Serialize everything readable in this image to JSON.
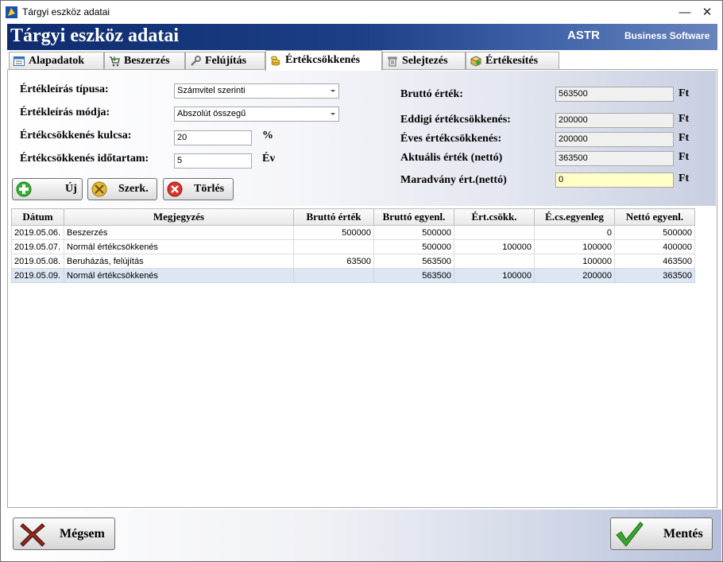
{
  "window": {
    "title": "Tárgyi eszköz adatai",
    "minimize": "—",
    "close": "✕"
  },
  "banner": {
    "heading": "Tárgyi eszköz adatai",
    "brand": "ASTR",
    "brand_sub": "Business Software"
  },
  "tabs": [
    {
      "label": "Alapadatok",
      "icon": "form-icon"
    },
    {
      "label": "Beszerzés",
      "icon": "cart-icon"
    },
    {
      "label": "Felújítás",
      "icon": "wrench-icon"
    },
    {
      "label": "Értékcsökkenés",
      "icon": "coins-icon",
      "active": true
    },
    {
      "label": "Selejtezés",
      "icon": "trash-icon"
    },
    {
      "label": "Értékesítés",
      "icon": "box-icon"
    }
  ],
  "form": {
    "type_label": "Értékleírás típusa:",
    "type_value": "Számvitel szerinti",
    "method_label": "Értékleírás módja:",
    "method_value": "Abszolút összegű",
    "rate_label": "Értékcsökkenés kulcsa:",
    "rate_value": "20",
    "rate_unit": "%",
    "duration_label": "Értékcsökkenés időtartam:",
    "duration_value": "5",
    "duration_unit": "Év",
    "gross_label": "Bruttó érték:",
    "gross_value": "563500",
    "todate_label": "Eddigi értékcsökkenés:",
    "todate_value": "200000",
    "annual_label": "Éves értékcsökkenés:",
    "annual_value": "200000",
    "current_label": "Aktuális érték (nettó)",
    "current_value": "363500",
    "residual_label": "Maradvány ért.(nettó)",
    "residual_value": "0",
    "currency": "Ft"
  },
  "actions": {
    "new": "Új",
    "edit": "Szerk.",
    "delete": "Törlés"
  },
  "table": {
    "headers": [
      "Dátum",
      "Megjegyzés",
      "Bruttó érték",
      "Bruttó egyenl.",
      "Ért.csökk.",
      "É.cs.egyenleg",
      "Nettó egyenl."
    ],
    "rows": [
      [
        "2019.05.06.",
        "Beszerzés",
        "500000",
        "500000",
        "",
        "0",
        "500000"
      ],
      [
        "2019.05.07.",
        "Normál értékcsökkenés",
        "",
        "500000",
        "100000",
        "100000",
        "400000"
      ],
      [
        "2019.05.08.",
        "Beruházás, felújítás",
        "63500",
        "563500",
        "",
        "100000",
        "463500"
      ],
      [
        "2019.05.09.",
        "Normál értékcsökkenés",
        "",
        "563500",
        "100000",
        "200000",
        "363500"
      ]
    ],
    "selected_row": 3
  },
  "footer": {
    "cancel": "Mégsem",
    "save": "Mentés"
  },
  "colors": {
    "banner": "#1c3f86",
    "accent_green": "#2fa82f",
    "accent_red": "#d9342b",
    "selection": "#dde6f3"
  }
}
